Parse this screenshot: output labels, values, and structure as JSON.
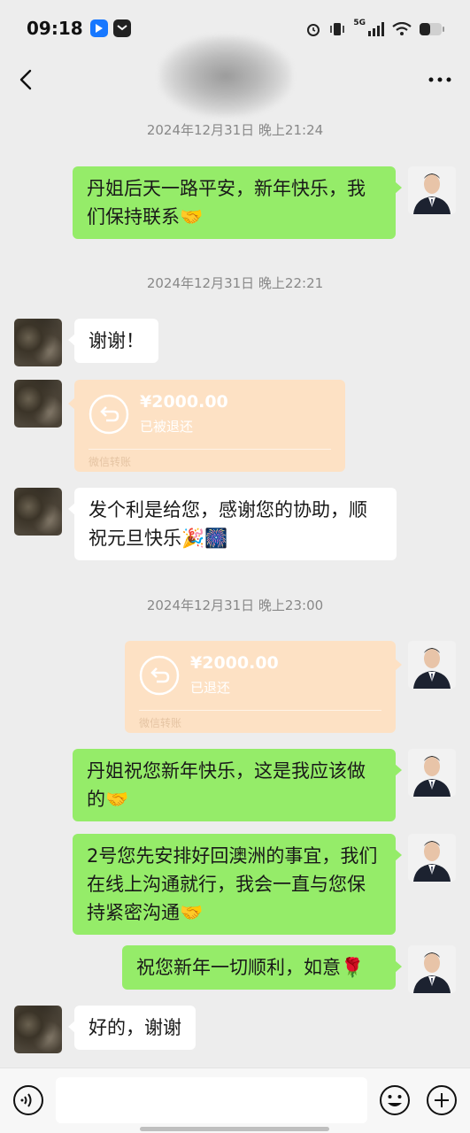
{
  "status_bar": {
    "time": "09:18",
    "network": "5G"
  },
  "header": {
    "back_icon": "chevron-left-icon",
    "more_icon": "more-dots-icon"
  },
  "messages": {
    "ts1": "2024年12月31日 晚上21:24",
    "m1": "丹姐后天一路平安，新年快乐，我们保持联系🤝",
    "ts2": "2024年12月31日 晚上22:21",
    "m2": "谢谢！",
    "transfer1": {
      "amount": "¥2000.00",
      "status": "已被退还",
      "brand": "微信转账"
    },
    "m3": "发个利是给您，感谢您的协助，顺祝元旦快乐🎉🎆",
    "ts3": "2024年12月31日 晚上23:00",
    "transfer2": {
      "amount": "¥2000.00",
      "status": "已退还",
      "brand": "微信转账"
    },
    "m4": "丹姐祝您新年快乐，这是我应该做的🤝",
    "m5": "2号您先安排好回澳洲的事宜，我们在线上沟通就行，我会一直与您保持紧密沟通🤝",
    "m6": "祝您新年一切顺利，如意🌹",
    "m7": "好的，谢谢"
  },
  "input_bar": {
    "placeholder": "",
    "voice_icon": "voice-icon",
    "emoji_icon": "emoji-icon",
    "plus_icon": "plus-icon"
  },
  "colors": {
    "self_bubble": "#95ec69",
    "other_bubble": "#ffffff",
    "transfer": "#fde1c4",
    "background": "#ededed"
  }
}
